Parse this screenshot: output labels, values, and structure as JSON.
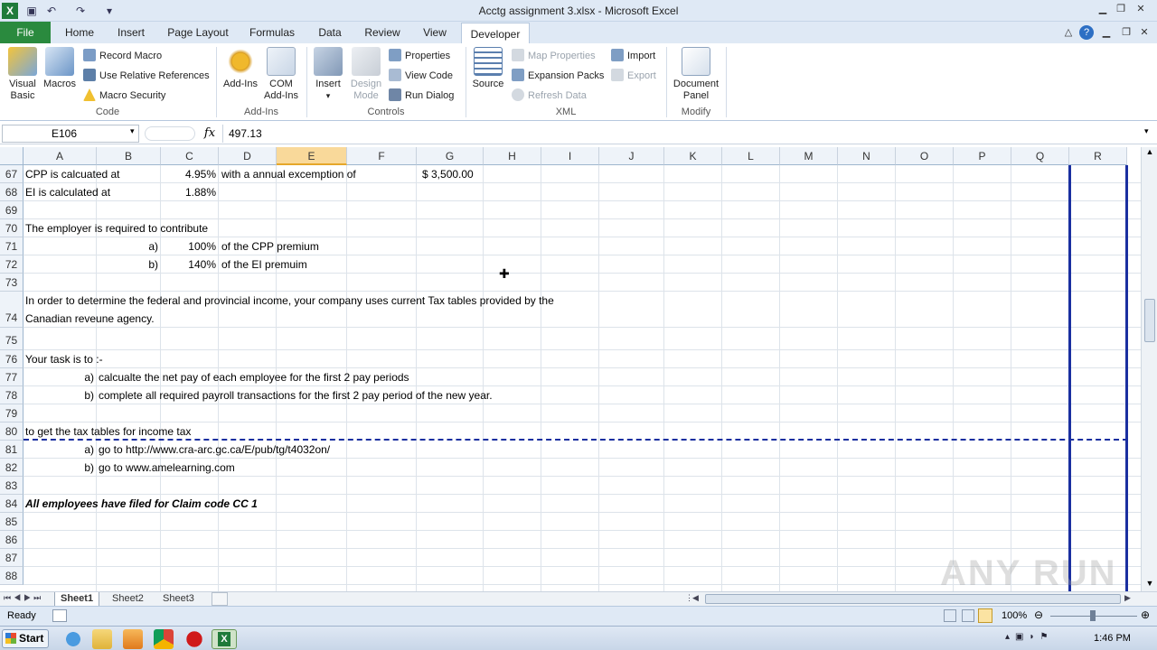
{
  "window": {
    "title": "Acctg assignment 3.xlsx - Microsoft Excel"
  },
  "tabs": [
    "File",
    "Home",
    "Insert",
    "Page Layout",
    "Formulas",
    "Data",
    "Review",
    "View",
    "Developer"
  ],
  "ribbon": {
    "code": {
      "label": "Code",
      "visual_basic": "Visual Basic",
      "macros": "Macros",
      "record_macro": "Record Macro",
      "relative_refs": "Use Relative References",
      "macro_security": "Macro Security"
    },
    "addins": {
      "label": "Add-Ins",
      "addins": "Add-Ins",
      "com_addins_1": "COM",
      "com_addins_2": "Add-Ins"
    },
    "controls": {
      "label": "Controls",
      "insert": "Insert",
      "design_mode_1": "Design",
      "design_mode_2": "Mode",
      "properties": "Properties",
      "view_code": "View Code",
      "run_dialog": "Run Dialog"
    },
    "xml": {
      "label": "XML",
      "source": "Source",
      "map_properties": "Map Properties",
      "expansion_packs": "Expansion Packs",
      "refresh_data": "Refresh Data",
      "import": "Import",
      "export": "Export"
    },
    "modify": {
      "label": "Modify",
      "document_panel_1": "Document",
      "document_panel_2": "Panel"
    }
  },
  "formula_bar": {
    "name_box": "E106",
    "fx": "fx",
    "value": "497.13"
  },
  "columns": [
    "A",
    "B",
    "C",
    "D",
    "E",
    "F",
    "G",
    "H",
    "I",
    "J",
    "K",
    "L",
    "M",
    "N",
    "O",
    "P",
    "Q",
    "R"
  ],
  "rows": [
    "67",
    "68",
    "69",
    "70",
    "71",
    "72",
    "73",
    "74",
    "75",
    "76",
    "77",
    "78",
    "79",
    "80",
    "81",
    "82",
    "83",
    "84",
    "85",
    "86",
    "87",
    "88"
  ],
  "cells": {
    "a67": "CPP is calcuated at",
    "c67": "4.95%",
    "d67": "with a annual excemption of",
    "g67": "$ 3,500.00",
    "a68": "EI is calculated at",
    "c68": "1.88%",
    "a70": "The employer is required to contribute",
    "b71": "a)",
    "c71": "100%",
    "d71": "of the CPP premium",
    "b72": "b)",
    "c72": "140%",
    "d72": "of the EI premuim",
    "a74_line1": "In order to determine the federal and provincial income, your company uses current Tax tables provided by the",
    "a74_line2": "Canadian reveune agency.",
    "a76": "Your task is to :-",
    "b77": "a)",
    "c77": "calcualte the net pay of each employee for the first 2 pay periods",
    "b78": "b)",
    "c78": "complete all required payroll transactions for the first 2 pay period of the new year.",
    "a80": "to get the tax tables for income tax",
    "b81": "a)",
    "c81": "go to http://www.cra-arc.gc.ca/E/pub/tg/t4032on/",
    "b82": "b)",
    "c82": "go to www.amelearning.com",
    "a84": "All employees have filed for Claim code CC 1"
  },
  "sheets": [
    "Sheet1",
    "Sheet2",
    "Sheet3"
  ],
  "status": {
    "ready": "Ready",
    "zoom": "100%"
  },
  "taskbar": {
    "start": "Start",
    "time": "1:46 PM"
  },
  "watermark": "ANY RUN",
  "colors": {
    "file_tab": "#2a8a3e",
    "selected_col": "#f9d99a",
    "page_break": "#1a2fa0"
  }
}
